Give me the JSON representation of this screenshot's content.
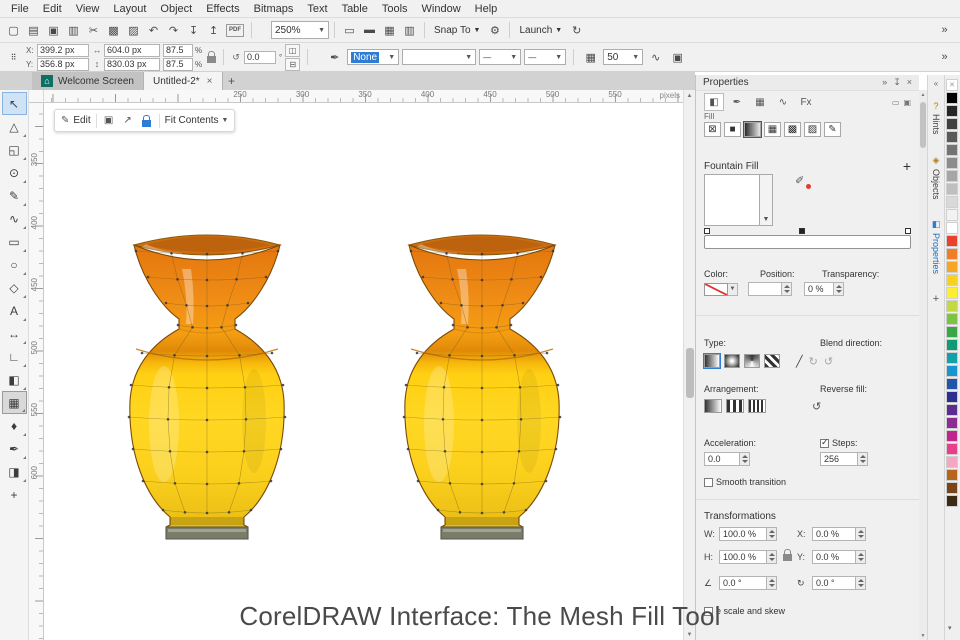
{
  "accent": "#2e7cd6",
  "caption": "CorelDRAW Interface: The Mesh Fill Tool",
  "menu": {
    "items": [
      "File",
      "Edit",
      "View",
      "Layout",
      "Object",
      "Effects",
      "Bitmaps",
      "Text",
      "Table",
      "Tools",
      "Window",
      "Help"
    ]
  },
  "toolbar": {
    "left_icons": [
      {
        "name": "new-document-icon",
        "glyph": "▢"
      },
      {
        "name": "open-icon",
        "glyph": "▤"
      },
      {
        "name": "save-icon",
        "glyph": "▣"
      },
      {
        "name": "print-icon",
        "glyph": "▥"
      },
      {
        "name": "cut-icon",
        "glyph": "✂"
      },
      {
        "name": "copy-icon",
        "glyph": "▩"
      },
      {
        "name": "paste-icon",
        "glyph": "▨"
      },
      {
        "name": "undo-icon",
        "glyph": "↶"
      },
      {
        "name": "redo-icon",
        "glyph": "↷"
      },
      {
        "name": "import-icon",
        "glyph": "↧"
      },
      {
        "name": "export-icon",
        "glyph": "↥"
      },
      {
        "name": "pdf-icon",
        "glyph": "PDF"
      }
    ],
    "zoom_value": "250%",
    "mid_icons": [
      {
        "name": "fullscreen-icon",
        "glyph": "▭"
      },
      {
        "name": "rulers-icon",
        "glyph": "▬"
      },
      {
        "name": "grid-icon",
        "glyph": "▦"
      },
      {
        "name": "guidelines-icon",
        "glyph": "▥"
      }
    ],
    "snap_label": "Snap To",
    "gear_glyph": "⚙",
    "launch_label": "Launch",
    "refresh_glyph": "↻",
    "collapse_glyph": "»"
  },
  "property_bar": {
    "x_label": "X:",
    "x_value": "399.2 px",
    "y_label": "Y:",
    "y_value": "356.8 px",
    "w_value": "604.0 px",
    "h_value": "830.03 px",
    "scale_top": "87.5",
    "scale_bottom": "87.5",
    "percent": "%",
    "angle_value": "0.0",
    "degree": "°",
    "outline_value": "None",
    "steps_value": "50"
  },
  "tabs": {
    "tab1": "Welcome Screen",
    "tab2": "Untitled-2*"
  },
  "ruler": {
    "h_ticks": [
      "250",
      "300",
      "350",
      "400",
      "450",
      "500",
      "550"
    ],
    "v_ticks": [
      "350",
      "400",
      "450",
      "500",
      "550",
      "600"
    ],
    "unit": "pixels"
  },
  "editbar": {
    "edit_label": "Edit",
    "fit_label": "Fit Contents"
  },
  "toolbox": {
    "tools": [
      {
        "name": "pick-tool",
        "glyph": "↖",
        "state": "selected"
      },
      {
        "name": "shape-tool",
        "glyph": "△",
        "fly": true
      },
      {
        "name": "crop-tool",
        "glyph": "◱",
        "fly": true
      },
      {
        "name": "zoom-tool",
        "glyph": "⊙",
        "fly": true
      },
      {
        "name": "freehand-tool",
        "glyph": "✎",
        "fly": true
      },
      {
        "name": "artistic-media-tool",
        "glyph": "∿",
        "fly": true
      },
      {
        "name": "rectangle-tool",
        "glyph": "▭",
        "fly": true
      },
      {
        "name": "ellipse-tool",
        "glyph": "○",
        "fly": true
      },
      {
        "name": "polygon-tool",
        "glyph": "◇",
        "fly": true
      },
      {
        "name": "text-tool",
        "glyph": "A",
        "fly": true
      },
      {
        "name": "dimension-tool",
        "glyph": "↔",
        "fly": true
      },
      {
        "name": "connector-tool",
        "glyph": "∟",
        "fly": true
      },
      {
        "name": "drop-shadow-tool",
        "glyph": "◧",
        "fly": true
      },
      {
        "name": "mesh-fill-tool",
        "glyph": "▦",
        "state": "active",
        "fly": true
      },
      {
        "name": "eyedropper-tool",
        "glyph": "♦",
        "fly": true
      },
      {
        "name": "outline-pen-tool",
        "glyph": "✒",
        "fly": true
      },
      {
        "name": "interactive-fill-tool",
        "glyph": "◨",
        "fly": true
      },
      {
        "name": "more-tools-button",
        "glyph": "+"
      }
    ]
  },
  "panel": {
    "title": "Properties",
    "pin_glyph": "↧",
    "close_glyph": "×",
    "chevrons_glyph": "»",
    "tab_icons": [
      {
        "name": "fill-tab-icon",
        "glyph": "◧",
        "active": true
      },
      {
        "name": "outline-tab-icon",
        "glyph": "✒"
      },
      {
        "name": "transparency-tab-icon",
        "glyph": "▦"
      },
      {
        "name": "curve-tab-icon",
        "glyph": "∿"
      },
      {
        "name": "effects-tab-icon",
        "glyph": "Fx"
      }
    ],
    "corner_icons": [
      {
        "name": "float-panel-icon",
        "glyph": "▭"
      },
      {
        "name": "expand-panel-icon",
        "glyph": "▣"
      }
    ],
    "fill_label": "Fill",
    "fill_type_icons": [
      {
        "name": "no-fill-button",
        "glyph": "⊠"
      },
      {
        "name": "uniform-fill-button",
        "glyph": "■"
      },
      {
        "name": "fountain-fill-button",
        "glyph": "",
        "cls": "grad",
        "active": true
      },
      {
        "name": "vector-pattern-button",
        "glyph": "▦"
      },
      {
        "name": "bitmap-pattern-button",
        "glyph": "▩"
      },
      {
        "name": "texture-fill-button",
        "glyph": "▨"
      },
      {
        "name": "edit-fill-button",
        "glyph": "✎"
      }
    ],
    "fountain_title": "Fountain Fill",
    "add_glyph": "+",
    "eyedropper_glyph": "✐",
    "color_label": "Color:",
    "position_label": "Position:",
    "transparency_label": "Transparency:",
    "transparency_value": "0 %",
    "type_label": "Type:",
    "blend_label": "Blend direction:",
    "blend_icons": [
      "╱",
      "↻",
      "↺"
    ],
    "arrangement_label": "Arrangement:",
    "reverse_label": "Reverse fill:",
    "reverse_glyph": "↺",
    "acceleration_label": "Acceleration:",
    "acceleration_value": "0.0",
    "steps_label": "Steps:",
    "steps_value": "256",
    "smooth_label": "Smooth transition",
    "transform_title": "Transformations",
    "w_label": "W:",
    "w_value": "100.0 %",
    "h_label": "H:",
    "h_value": "100.0 %",
    "x_label": "X:",
    "x_value": "0.0 %",
    "y_label": "Y:",
    "y_value": "0.0 %",
    "angle_icon": "∠",
    "angle1_value": "0.0 °",
    "skew_icon": "↻",
    "angle2_value": "0.0 °",
    "scale_skew_label": "e scale and skew"
  },
  "dockers": {
    "collapse_glyph": "«",
    "tabs": [
      {
        "name": "docker-tab-hints",
        "label": "Hints",
        "glyph": "?"
      },
      {
        "name": "docker-tab-objects",
        "label": "Objects",
        "glyph": "◈"
      },
      {
        "name": "docker-tab-properties",
        "label": "Properties",
        "glyph": "◧",
        "active": true
      }
    ],
    "add_glyph": "+"
  },
  "palette": {
    "colors": [
      "none",
      "#000000",
      "#262626",
      "#404040",
      "#595959",
      "#737373",
      "#8c8c8c",
      "#a6a6a6",
      "#bfbfbf",
      "#d9d9d9",
      "#f2f2f2",
      "#ffffff",
      "#e8412c",
      "#f07e28",
      "#f5a623",
      "#f7d21e",
      "#fdee30",
      "#c2d940",
      "#7dc242",
      "#3aa648",
      "#0f9b74",
      "#14a0a8",
      "#1894d1",
      "#2356a8",
      "#2c2f8f",
      "#5b2d91",
      "#8c2d91",
      "#c0268d",
      "#e83e8c",
      "#f4a7c3",
      "#b5651d",
      "#7a4419",
      "#3e2a14"
    ],
    "down_glyph": "▾"
  },
  "vase": {
    "top_color": "#ef8c15",
    "bottom_color": "#ffd013",
    "foot_color": "#7a7c6a"
  }
}
